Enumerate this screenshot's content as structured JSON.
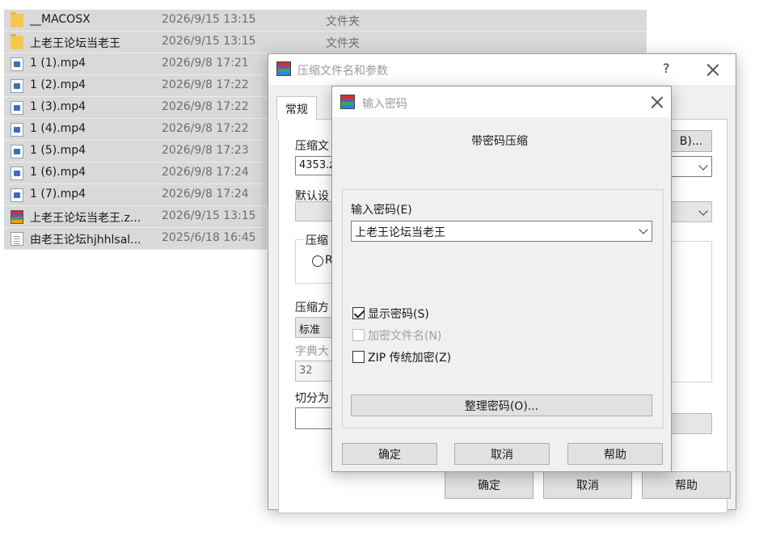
{
  "files": [
    {
      "name": "__MACOSX",
      "date": "2026/9/15 13:15",
      "type": "文件夹",
      "icon": "folder-icon"
    },
    {
      "name": "上老王论坛当老王",
      "date": "2026/9/15 13:15",
      "type": "文件夹",
      "icon": "folder-icon"
    },
    {
      "name": "1 (1).mp4",
      "date": "2026/9/8 17:21",
      "type": "",
      "icon": "video-file-icon"
    },
    {
      "name": "1 (2).mp4",
      "date": "2026/9/8 17:22",
      "type": "",
      "icon": "video-file-icon"
    },
    {
      "name": "1 (3).mp4",
      "date": "2026/9/8 17:22",
      "type": "",
      "icon": "video-file-icon"
    },
    {
      "name": "1 (4).mp4",
      "date": "2026/9/8 17:22",
      "type": "",
      "icon": "video-file-icon"
    },
    {
      "name": "1 (5).mp4",
      "date": "2026/9/8 17:23",
      "type": "",
      "icon": "video-file-icon"
    },
    {
      "name": "1 (6).mp4",
      "date": "2026/9/8 17:24",
      "type": "",
      "icon": "video-file-icon"
    },
    {
      "name": "1 (7).mp4",
      "date": "2026/9/8 17:24",
      "type": "",
      "icon": "video-file-icon"
    },
    {
      "name": "上老王论坛当老王.z...",
      "date": "2026/9/15 13:15",
      "type": "",
      "icon": "rar-archive-icon"
    },
    {
      "name": "由老王论坛hjhhlsal...",
      "date": "2025/6/18 16:45",
      "type": "",
      "icon": "text-file-icon"
    }
  ],
  "archive_dialog": {
    "title": "压缩文件名和参数",
    "help": "?",
    "tab_general": "常规",
    "archive_name_label": "压缩文",
    "archive_name_value": "4353.z",
    "browse_button": "B)...",
    "default_profile_label": "默认设",
    "format_label": "压缩",
    "format_option": "R",
    "method_label": "压缩方",
    "method_value": "标准",
    "dict_label": "字典大",
    "dict_value": "32",
    "split_label": "切分为",
    "ok": "确定",
    "cancel": "取消",
    "help_button": "帮助"
  },
  "password_dialog": {
    "title": "输入密码",
    "heading": "带密码压缩",
    "password_label": "输入密码(E)",
    "password_value": "上老王论坛当老王",
    "show_password": "显示密码(S)",
    "encrypt_names": "加密文件名(N)",
    "zip_legacy": "ZIP 传统加密(Z)",
    "organize_button": "整理密码(O)...",
    "ok": "确定",
    "cancel": "取消",
    "help_button": "帮助"
  }
}
